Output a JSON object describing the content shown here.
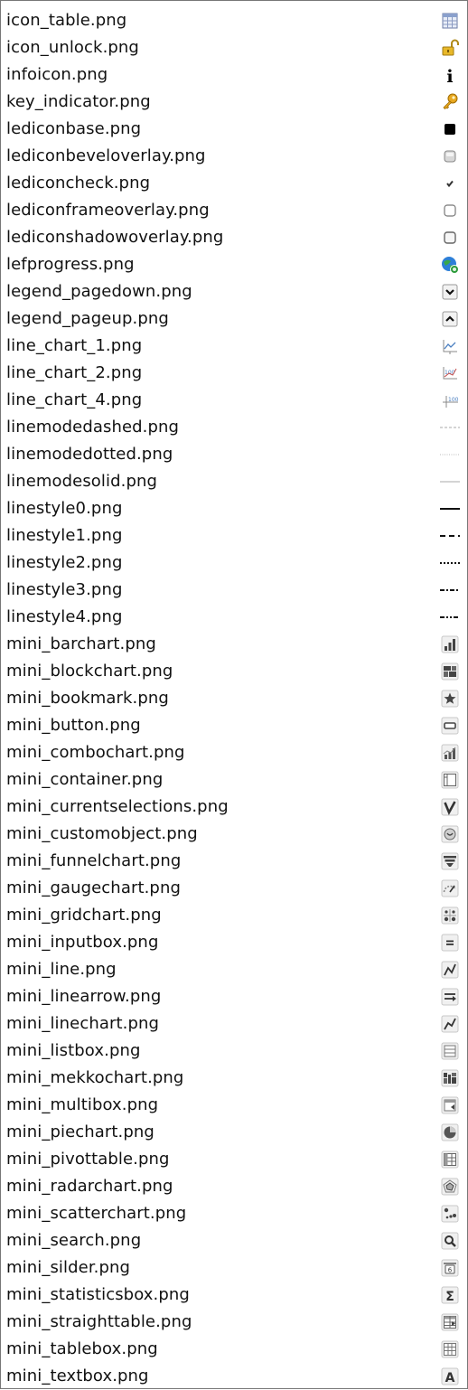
{
  "files": [
    {
      "label": "icon_table.png",
      "icon": "table-icon"
    },
    {
      "label": "icon_unlock.png",
      "icon": "unlock-icon"
    },
    {
      "label": "infoicon.png",
      "icon": "info-icon"
    },
    {
      "label": "key_indicator.png",
      "icon": "key-icon"
    },
    {
      "label": "lediconbase.png",
      "icon": "led-base-icon"
    },
    {
      "label": "lediconbeveloverlay.png",
      "icon": "led-bevel-overlay-icon"
    },
    {
      "label": "lediconcheck.png",
      "icon": "led-check-icon"
    },
    {
      "label": "lediconframeoverlay.png",
      "icon": "led-frame-overlay-icon"
    },
    {
      "label": "lediconshadowoverlay.png",
      "icon": "led-shadow-overlay-icon"
    },
    {
      "label": "lefprogress.png",
      "icon": "progress-globe-icon"
    },
    {
      "label": "legend_pagedown.png",
      "icon": "page-down-icon"
    },
    {
      "label": "legend_pageup.png",
      "icon": "page-up-icon"
    },
    {
      "label": "line_chart_1.png",
      "icon": "line-chart-1-icon"
    },
    {
      "label": "line_chart_2.png",
      "icon": "line-chart-2-icon"
    },
    {
      "label": "line_chart_4.png",
      "icon": "line-chart-4-icon"
    },
    {
      "label": "linemodedashed.png",
      "icon": "line-mode-dashed-icon"
    },
    {
      "label": "linemodedotted.png",
      "icon": "line-mode-dotted-icon"
    },
    {
      "label": "linemodesolid.png",
      "icon": "line-mode-solid-icon"
    },
    {
      "label": "linestyle0.png",
      "icon": "line-style-0-icon"
    },
    {
      "label": "linestyle1.png",
      "icon": "line-style-1-icon"
    },
    {
      "label": "linestyle2.png",
      "icon": "line-style-2-icon"
    },
    {
      "label": "linestyle3.png",
      "icon": "line-style-3-icon"
    },
    {
      "label": "linestyle4.png",
      "icon": "line-style-4-icon"
    },
    {
      "label": "mini_barchart.png",
      "icon": "bar-chart-icon"
    },
    {
      "label": "mini_blockchart.png",
      "icon": "block-chart-icon"
    },
    {
      "label": "mini_bookmark.png",
      "icon": "bookmark-star-icon"
    },
    {
      "label": "mini_button.png",
      "icon": "button-icon"
    },
    {
      "label": "mini_combochart.png",
      "icon": "combo-chart-icon"
    },
    {
      "label": "mini_container.png",
      "icon": "container-icon"
    },
    {
      "label": "mini_currentselections.png",
      "icon": "current-selections-icon"
    },
    {
      "label": "mini_customobject.png",
      "icon": "custom-object-icon"
    },
    {
      "label": "mini_funnelchart.png",
      "icon": "funnel-chart-icon"
    },
    {
      "label": "mini_gaugechart.png",
      "icon": "gauge-chart-icon"
    },
    {
      "label": "mini_gridchart.png",
      "icon": "grid-chart-icon"
    },
    {
      "label": "mini_inputbox.png",
      "icon": "input-box-icon"
    },
    {
      "label": "mini_line.png",
      "icon": "line-icon"
    },
    {
      "label": "mini_linearrow.png",
      "icon": "line-arrow-icon"
    },
    {
      "label": "mini_linechart.png",
      "icon": "line-chart-icon"
    },
    {
      "label": "mini_listbox.png",
      "icon": "list-box-icon"
    },
    {
      "label": "mini_mekkochart.png",
      "icon": "mekko-chart-icon"
    },
    {
      "label": "mini_multibox.png",
      "icon": "multi-box-icon"
    },
    {
      "label": "mini_piechart.png",
      "icon": "pie-chart-icon"
    },
    {
      "label": "mini_pivottable.png",
      "icon": "pivot-table-icon"
    },
    {
      "label": "mini_radarchart.png",
      "icon": "radar-chart-icon"
    },
    {
      "label": "mini_scatterchart.png",
      "icon": "scatter-chart-icon"
    },
    {
      "label": "mini_search.png",
      "icon": "search-icon"
    },
    {
      "label": "mini_silder.png",
      "icon": "slider-icon"
    },
    {
      "label": "mini_statisticsbox.png",
      "icon": "sigma-statistics-icon"
    },
    {
      "label": "mini_straighttable.png",
      "icon": "straight-table-icon"
    },
    {
      "label": "mini_tablebox.png",
      "icon": "table-box-icon"
    },
    {
      "label": "mini_textbox.png",
      "icon": "text-box-icon"
    }
  ]
}
